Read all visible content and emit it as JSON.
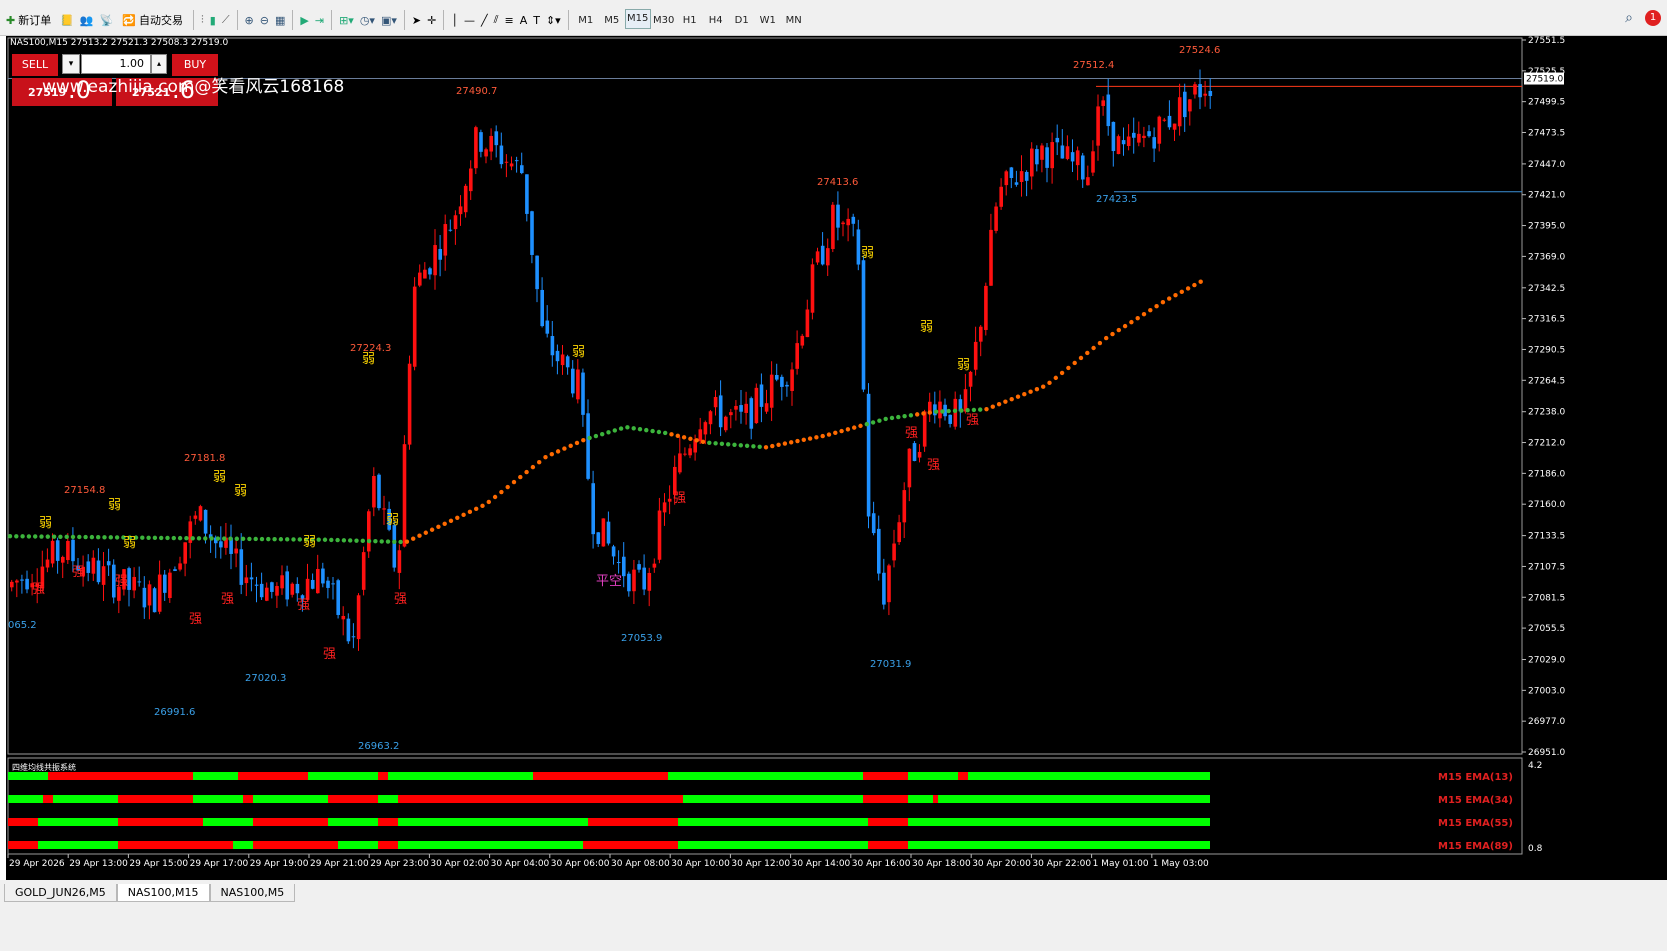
{
  "toolbar": {
    "new_order": "新订单",
    "auto_trading": "自动交易",
    "timeframes": [
      "M1",
      "M5",
      "M15",
      "M30",
      "H1",
      "H4",
      "D1",
      "W1",
      "MN"
    ],
    "active_timeframe": "M15"
  },
  "chart": {
    "title": "NAS100,M15  27513.2 27521.3 27508.3 27519.0",
    "watermark": "www.eazhijia.com@笑看风云168168",
    "current_price": "27519.0",
    "price_axis": [
      "27551.5",
      "27525.5",
      "27499.5",
      "27473.5",
      "27447.0",
      "27421.0",
      "27395.0",
      "27369.0",
      "27342.5",
      "27316.5",
      "27290.5",
      "27264.5",
      "27238.0",
      "27212.0",
      "27186.0",
      "27160.0",
      "27133.5",
      "27107.5",
      "27081.5",
      "27055.5",
      "27029.0",
      "27003.0",
      "26977.0",
      "26951.0"
    ],
    "time_axis": [
      "29 Apr 2026",
      "29 Apr 13:00",
      "29 Apr 15:00",
      "29 Apr 17:00",
      "29 Apr 19:00",
      "29 Apr 21:00",
      "29 Apr 23:00",
      "30 Apr 02:00",
      "30 Apr 04:00",
      "30 Apr 06:00",
      "30 Apr 08:00",
      "30 Apr 10:00",
      "30 Apr 12:00",
      "30 Apr 14:00",
      "30 Apr 16:00",
      "30 Apr 18:00",
      "30 Apr 20:00",
      "30 Apr 22:00",
      "1 May 01:00",
      "1 May 03:00"
    ],
    "price_labels_red": [
      "27154.8",
      "27181.8",
      "27224.3",
      "27490.7",
      "27413.6",
      "27512.4",
      "27524.6"
    ],
    "price_labels_blue": [
      "065.2",
      "26991.6",
      "27020.3",
      "26963.2",
      "27053.9",
      "27031.9",
      "27423.5"
    ],
    "signal_weak": "弱",
    "signal_strong": "强",
    "signal_flat": "平空"
  },
  "trade_panel": {
    "sell_label": "SELL",
    "buy_label": "BUY",
    "lot": "1.00",
    "bid_small": "27519",
    "bid_big": ".0",
    "ask_small": "27521",
    "ask_big": ".6"
  },
  "indicator": {
    "title": "四维均线共振系统",
    "rows": [
      "M15 EMA(13)",
      "M15 EMA(34)",
      "M15 EMA(55)",
      "M15 EMA(89)"
    ],
    "scale_top": "4.2",
    "scale_bottom": "0.8"
  },
  "tabs": [
    "GOLD_JUN26,M5",
    "NAS100,M15",
    "NAS100,M5"
  ],
  "active_tab": "NAS100,M15",
  "colors": {
    "bull": "#ff1010",
    "bear": "#1e90ff",
    "ema_up": "#ff6a00",
    "ema_flat": "#3cb43c",
    "weak": "#ffd700",
    "strong": "#ff2020",
    "ind_green": "#00ff00",
    "ind_red": "#ff0000"
  }
}
